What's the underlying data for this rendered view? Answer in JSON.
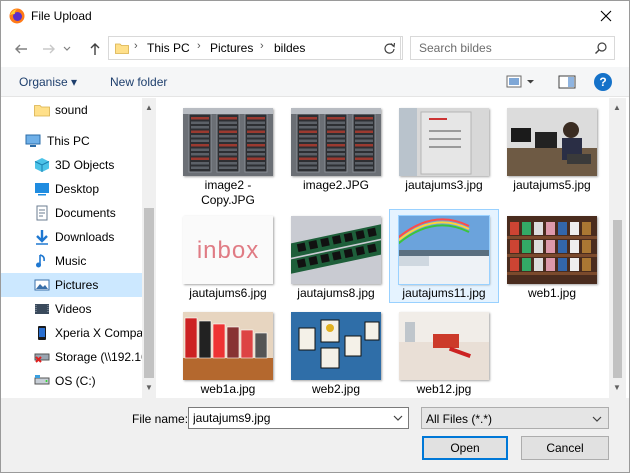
{
  "window": {
    "title": "File Upload",
    "close_glyph": "✕"
  },
  "nav": {
    "back_icon": "back-arrow-icon",
    "forward_icon": "forward-arrow-icon",
    "recent_icon": "chevron-down-icon",
    "up_icon": "up-arrow-icon",
    "breadcrumb": [
      "This PC",
      "Pictures",
      "bildes"
    ],
    "search_placeholder": "Search bildes"
  },
  "toolbar": {
    "organise": "Organise ▾",
    "new_folder": "New folder",
    "help": "?"
  },
  "sidebar": {
    "items": [
      {
        "label": "sound",
        "icon": "folder-icon",
        "indent": 2,
        "selected": false
      },
      {
        "label": "This PC",
        "icon": "pc-icon",
        "indent": 1,
        "selected": false
      },
      {
        "label": "3D Objects",
        "icon": "cube-icon",
        "indent": 2,
        "selected": false
      },
      {
        "label": "Desktop",
        "icon": "desktop-icon",
        "indent": 2,
        "selected": false
      },
      {
        "label": "Documents",
        "icon": "documents-icon",
        "indent": 2,
        "selected": false
      },
      {
        "label": "Downloads",
        "icon": "download-icon",
        "indent": 2,
        "selected": false
      },
      {
        "label": "Music",
        "icon": "music-icon",
        "indent": 2,
        "selected": false
      },
      {
        "label": "Pictures",
        "icon": "pictures-icon",
        "indent": 2,
        "selected": true
      },
      {
        "label": "Videos",
        "icon": "videos-icon",
        "indent": 2,
        "selected": false
      },
      {
        "label": "Xperia X Compa",
        "icon": "phone-icon",
        "indent": 2,
        "selected": false
      },
      {
        "label": "Storage (\\\\192.16",
        "icon": "network-drive-icon",
        "indent": 2,
        "selected": false
      },
      {
        "label": "OS (C:)",
        "icon": "drive-icon",
        "indent": 2,
        "selected": false
      }
    ]
  },
  "files": [
    {
      "name": "image2 -\nCopy.JPG",
      "thumb": "server-rack",
      "selected": false
    },
    {
      "name": "image2.JPG",
      "thumb": "server-rack",
      "selected": false
    },
    {
      "name": "jautajums3.jpg",
      "thumb": "sign",
      "selected": false
    },
    {
      "name": "jautajums5.jpg",
      "thumb": "office",
      "selected": false
    },
    {
      "name": "jautajums6.jpg",
      "thumb": "inbox",
      "selected": false
    },
    {
      "name": "jautajums8.jpg",
      "thumb": "ram",
      "selected": false
    },
    {
      "name": "jautajums11.jpg",
      "thumb": "rainbow",
      "selected": true
    },
    {
      "name": "web1.jpg",
      "thumb": "shelves",
      "selected": false
    },
    {
      "name": "web1a.jpg",
      "thumb": "books",
      "selected": false
    },
    {
      "name": "web2.jpg",
      "thumb": "frames",
      "selected": false
    },
    {
      "name": "web12.jpg",
      "thumb": "desk",
      "selected": false
    }
  ],
  "inbox_text": "inbox",
  "bottom": {
    "file_name_label": "File name:",
    "file_name_value": "jautajums9.jpg",
    "file_type": "All Files (*.*)",
    "open": "Open",
    "cancel": "Cancel"
  },
  "colors": {
    "accent": "#0078d7",
    "selected": "#cce8ff",
    "link": "#1e3f6d"
  }
}
